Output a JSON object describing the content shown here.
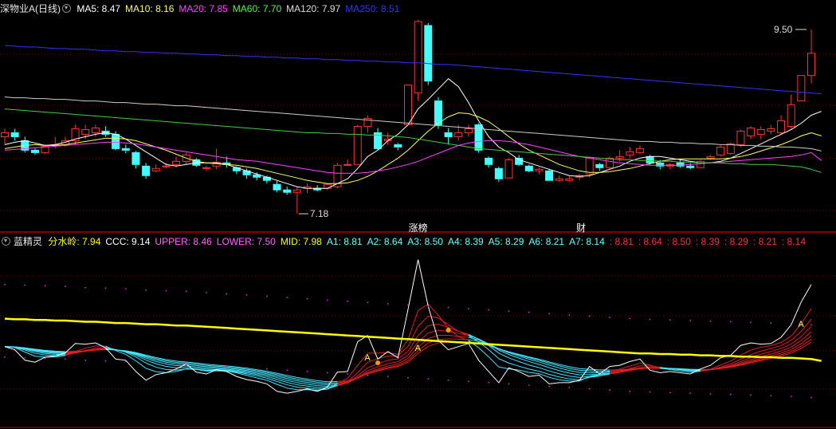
{
  "top_panel": {
    "title": "深物业A(日线)",
    "ma": [
      {
        "label": "MA5: 8.47",
        "color": "#ffffff"
      },
      {
        "label": "MA10: 8.16",
        "color": "#ffff66"
      },
      {
        "label": "MA20: 7.85",
        "color": "#ff44ff"
      },
      {
        "label": "MA60: 7.70",
        "color": "#44ff44"
      },
      {
        "label": "MA120: 7.97",
        "color": "#dddddd"
      },
      {
        "label": "MA250: 8.51",
        "color": "#3333ff"
      }
    ],
    "annotations": {
      "high_label": "9.50",
      "low_label": "7.18",
      "tag1": "涨榜",
      "tag2": "财"
    }
  },
  "bottom_panel": {
    "title": "蓝精灵",
    "items": [
      {
        "label": "分水岭: 7.94",
        "color": "#ffff00"
      },
      {
        "label": "CCC: 9.14",
        "color": "#ffffff"
      },
      {
        "label": "UPPER: 8.46",
        "color": "#ff66ff"
      },
      {
        "label": "LOWER: 7.50",
        "color": "#ff66ff"
      },
      {
        "label": "MID: 7.98",
        "color": "#ffff00"
      },
      {
        "label": "A1: 8.81",
        "color": "#66ffff"
      },
      {
        "label": "A2: 8.64",
        "color": "#66ffff"
      },
      {
        "label": "A3: 8.50",
        "color": "#66ffff"
      },
      {
        "label": "A4: 8.39",
        "color": "#66ffff"
      },
      {
        "label": "A5: 8.29",
        "color": "#66ffff"
      },
      {
        "label": "A6: 8.21",
        "color": "#66ffff"
      },
      {
        "label": "A7: 8.14",
        "color": "#66ffff"
      },
      {
        "label": ": 8.81",
        "color": "#ff3333"
      },
      {
        "label": ": 8.64",
        "color": "#ff3333"
      },
      {
        "label": ": 8.50",
        "color": "#ff3333"
      },
      {
        "label": ": 8.39",
        "color": "#ff3333"
      },
      {
        "label": ": 8.29",
        "color": "#ff3333"
      },
      {
        "label": ": 8.21",
        "color": "#ff3333"
      },
      {
        "label": ": 8.14",
        "color": "#ff3333"
      }
    ],
    "marker_letter": "A"
  },
  "colors": {
    "up": "#ff3333",
    "down": "#44ffff",
    "grid": "#7a0000",
    "axis": "#b00000"
  },
  "chart_data": {
    "type": "candlestick",
    "ylim": [
      7.0,
      9.65
    ],
    "grid": true,
    "candles": [
      {
        "o": 8.15,
        "h": 8.25,
        "l": 8.05,
        "c": 8.2
      },
      {
        "o": 8.2,
        "h": 8.25,
        "l": 8.1,
        "c": 8.15
      },
      {
        "o": 8.1,
        "h": 8.15,
        "l": 7.95,
        "c": 7.98
      },
      {
        "o": 7.98,
        "h": 8.0,
        "l": 7.92,
        "c": 7.95
      },
      {
        "o": 7.95,
        "h": 8.05,
        "l": 7.93,
        "c": 8.03
      },
      {
        "o": 8.05,
        "h": 8.15,
        "l": 8.0,
        "c": 8.05
      },
      {
        "o": 8.05,
        "h": 8.15,
        "l": 8.02,
        "c": 8.1
      },
      {
        "o": 8.1,
        "h": 8.3,
        "l": 8.05,
        "c": 8.25
      },
      {
        "o": 8.18,
        "h": 8.3,
        "l": 8.12,
        "c": 8.24
      },
      {
        "o": 8.2,
        "h": 8.3,
        "l": 8.15,
        "c": 8.26
      },
      {
        "o": 8.22,
        "h": 8.28,
        "l": 8.15,
        "c": 8.18
      },
      {
        "o": 8.18,
        "h": 8.22,
        "l": 7.98,
        "c": 8.0
      },
      {
        "o": 8.0,
        "h": 8.05,
        "l": 7.94,
        "c": 7.98
      },
      {
        "o": 7.95,
        "h": 7.97,
        "l": 7.75,
        "c": 7.8
      },
      {
        "o": 7.78,
        "h": 7.82,
        "l": 7.62,
        "c": 7.66
      },
      {
        "o": 7.72,
        "h": 7.8,
        "l": 7.7,
        "c": 7.75
      },
      {
        "o": 7.78,
        "h": 7.82,
        "l": 7.75,
        "c": 7.78
      },
      {
        "o": 7.8,
        "h": 7.9,
        "l": 7.76,
        "c": 7.84
      },
      {
        "o": 7.84,
        "h": 7.95,
        "l": 7.8,
        "c": 7.92
      },
      {
        "o": 7.86,
        "h": 7.88,
        "l": 7.77,
        "c": 7.79
      },
      {
        "o": 7.75,
        "h": 7.78,
        "l": 7.72,
        "c": 7.76
      },
      {
        "o": 7.78,
        "h": 8.0,
        "l": 7.74,
        "c": 7.83
      },
      {
        "o": 7.82,
        "h": 7.9,
        "l": 7.76,
        "c": 7.8
      },
      {
        "o": 7.76,
        "h": 7.78,
        "l": 7.68,
        "c": 7.72
      },
      {
        "o": 7.72,
        "h": 7.75,
        "l": 7.62,
        "c": 7.67
      },
      {
        "o": 7.67,
        "h": 7.7,
        "l": 7.6,
        "c": 7.64
      },
      {
        "o": 7.64,
        "h": 7.66,
        "l": 7.56,
        "c": 7.6
      },
      {
        "o": 7.55,
        "h": 7.6,
        "l": 7.45,
        "c": 7.48
      },
      {
        "o": 7.48,
        "h": 7.52,
        "l": 7.42,
        "c": 7.45
      },
      {
        "o": 7.45,
        "h": 7.52,
        "l": 7.18,
        "c": 7.48
      },
      {
        "o": 7.5,
        "h": 7.56,
        "l": 7.44,
        "c": 7.52
      },
      {
        "o": 7.5,
        "h": 7.54,
        "l": 7.46,
        "c": 7.48
      },
      {
        "o": 7.5,
        "h": 7.56,
        "l": 7.48,
        "c": 7.55
      },
      {
        "o": 7.52,
        "h": 7.82,
        "l": 7.5,
        "c": 7.79
      },
      {
        "o": 7.8,
        "h": 7.86,
        "l": 7.78,
        "c": 7.8
      },
      {
        "o": 7.8,
        "h": 8.3,
        "l": 7.82,
        "c": 8.28
      },
      {
        "o": 8.28,
        "h": 8.42,
        "l": 8.2,
        "c": 8.38
      },
      {
        "o": 8.2,
        "h": 8.26,
        "l": 7.98,
        "c": 8.0
      },
      {
        "o": 8.1,
        "h": 8.2,
        "l": 8.05,
        "c": 8.12
      },
      {
        "o": 8.05,
        "h": 8.07,
        "l": 7.98,
        "c": 8.02
      },
      {
        "o": 8.3,
        "h": 8.8,
        "l": 8.3,
        "c": 8.8
      },
      {
        "o": 8.7,
        "h": 9.62,
        "l": 8.6,
        "c": 9.6
      },
      {
        "o": 9.55,
        "h": 9.58,
        "l": 8.8,
        "c": 8.85
      },
      {
        "o": 8.6,
        "h": 8.65,
        "l": 8.25,
        "c": 8.3
      },
      {
        "o": 8.2,
        "h": 8.26,
        "l": 8.05,
        "c": 8.15
      },
      {
        "o": 8.15,
        "h": 8.3,
        "l": 8.1,
        "c": 8.2
      },
      {
        "o": 8.2,
        "h": 8.3,
        "l": 8.15,
        "c": 8.25
      },
      {
        "o": 8.3,
        "h": 8.32,
        "l": 7.95,
        "c": 7.98
      },
      {
        "o": 7.88,
        "h": 7.9,
        "l": 7.76,
        "c": 7.8
      },
      {
        "o": 7.75,
        "h": 7.77,
        "l": 7.58,
        "c": 7.62
      },
      {
        "o": 7.63,
        "h": 7.88,
        "l": 7.63,
        "c": 7.86
      },
      {
        "o": 7.88,
        "h": 7.92,
        "l": 7.78,
        "c": 7.8
      },
      {
        "o": 7.78,
        "h": 7.8,
        "l": 7.7,
        "c": 7.72
      },
      {
        "o": 7.72,
        "h": 7.76,
        "l": 7.68,
        "c": 7.74
      },
      {
        "o": 7.72,
        "h": 7.74,
        "l": 7.6,
        "c": 7.6
      },
      {
        "o": 7.6,
        "h": 7.66,
        "l": 7.58,
        "c": 7.62
      },
      {
        "o": 7.6,
        "h": 7.66,
        "l": 7.58,
        "c": 7.62
      },
      {
        "o": 7.64,
        "h": 7.68,
        "l": 7.6,
        "c": 7.66
      },
      {
        "o": 7.68,
        "h": 7.9,
        "l": 7.64,
        "c": 7.88
      },
      {
        "o": 7.8,
        "h": 7.82,
        "l": 7.72,
        "c": 7.76
      },
      {
        "o": 7.76,
        "h": 7.9,
        "l": 7.74,
        "c": 7.88
      },
      {
        "o": 7.88,
        "h": 7.98,
        "l": 7.84,
        "c": 7.9
      },
      {
        "o": 7.92,
        "h": 8.02,
        "l": 7.88,
        "c": 7.96
      },
      {
        "o": 7.95,
        "h": 8.04,
        "l": 7.93,
        "c": 8.0
      },
      {
        "o": 7.9,
        "h": 7.92,
        "l": 7.8,
        "c": 7.82
      },
      {
        "o": 7.82,
        "h": 7.86,
        "l": 7.74,
        "c": 7.78
      },
      {
        "o": 7.78,
        "h": 7.82,
        "l": 7.74,
        "c": 7.8
      },
      {
        "o": 7.82,
        "h": 7.86,
        "l": 7.76,
        "c": 7.78
      },
      {
        "o": 7.78,
        "h": 7.82,
        "l": 7.74,
        "c": 7.76
      },
      {
        "o": 7.76,
        "h": 7.86,
        "l": 7.76,
        "c": 7.84
      },
      {
        "o": 7.88,
        "h": 7.92,
        "l": 7.86,
        "c": 7.9
      },
      {
        "o": 7.92,
        "h": 8.04,
        "l": 7.9,
        "c": 8.02
      },
      {
        "o": 7.94,
        "h": 8.08,
        "l": 7.92,
        "c": 8.06
      },
      {
        "o": 8.05,
        "h": 8.24,
        "l": 8.02,
        "c": 8.22
      },
      {
        "o": 8.16,
        "h": 8.28,
        "l": 8.12,
        "c": 8.26
      },
      {
        "o": 8.18,
        "h": 8.28,
        "l": 8.12,
        "c": 8.24
      },
      {
        "o": 8.22,
        "h": 8.3,
        "l": 8.18,
        "c": 8.25
      },
      {
        "o": 8.2,
        "h": 8.42,
        "l": 8.18,
        "c": 8.35
      },
      {
        "o": 8.28,
        "h": 8.68,
        "l": 8.25,
        "c": 8.55
      },
      {
        "o": 8.6,
        "h": 8.92,
        "l": 8.6,
        "c": 8.92
      },
      {
        "o": 8.92,
        "h": 9.5,
        "l": 8.82,
        "c": 9.2
      }
    ],
    "ma_series": {
      "MA5": [
        8.05,
        8.08,
        8.1,
        8.07,
        8.04,
        8.05,
        8.08,
        8.12,
        8.15,
        8.18,
        8.2,
        8.18,
        8.12,
        8.04,
        7.96,
        7.88,
        7.8,
        7.78,
        7.8,
        7.82,
        7.82,
        7.82,
        7.8,
        7.76,
        7.72,
        7.68,
        7.64,
        7.6,
        7.56,
        7.52,
        7.5,
        7.5,
        7.5,
        7.56,
        7.62,
        7.75,
        7.9,
        7.98,
        8.1,
        8.18,
        8.3,
        8.5,
        8.62,
        8.75,
        8.88,
        8.78,
        8.58,
        8.35,
        8.15,
        8.02,
        7.95,
        7.86,
        7.82,
        7.78,
        7.74,
        7.7,
        7.66,
        7.65,
        7.66,
        7.7,
        7.74,
        7.78,
        7.84,
        7.88,
        7.9,
        7.9,
        7.88,
        7.86,
        7.84,
        7.82,
        7.82,
        7.84,
        7.88,
        7.94,
        8.0,
        8.06,
        8.12,
        8.18,
        8.24,
        8.32,
        8.42,
        8.47
      ],
      "MA10": [
        8.0,
        8.02,
        8.04,
        8.05,
        8.04,
        8.04,
        8.05,
        8.07,
        8.09,
        8.11,
        8.13,
        8.13,
        8.12,
        8.1,
        8.06,
        8.02,
        7.98,
        7.93,
        7.88,
        7.84,
        7.82,
        7.81,
        7.8,
        7.79,
        7.77,
        7.75,
        7.72,
        7.69,
        7.66,
        7.63,
        7.6,
        7.58,
        7.56,
        7.56,
        7.57,
        7.6,
        7.65,
        7.72,
        7.8,
        7.88,
        7.98,
        8.1,
        8.22,
        8.32,
        8.4,
        8.45,
        8.44,
        8.4,
        8.34,
        8.25,
        8.15,
        8.06,
        7.98,
        7.92,
        7.86,
        7.8,
        7.76,
        7.72,
        7.7,
        7.7,
        7.71,
        7.73,
        7.75,
        7.78,
        7.81,
        7.84,
        7.86,
        7.87,
        7.87,
        7.87,
        7.87,
        7.87,
        7.88,
        7.9,
        7.93,
        7.97,
        8.01,
        8.05,
        8.1,
        8.16,
        8.2,
        8.16
      ],
      "MA20": [
        7.98,
        7.99,
        8.0,
        8.01,
        8.02,
        8.03,
        8.04,
        8.05,
        8.06,
        8.07,
        8.08,
        8.08,
        8.07,
        8.06,
        8.04,
        8.02,
        8.0,
        7.98,
        7.96,
        7.94,
        7.92,
        7.9,
        7.88,
        7.86,
        7.85,
        7.84,
        7.82,
        7.8,
        7.78,
        7.76,
        7.74,
        7.72,
        7.7,
        7.69,
        7.69,
        7.69,
        7.7,
        7.72,
        7.74,
        7.77,
        7.8,
        7.84,
        7.89,
        7.94,
        7.99,
        8.04,
        8.07,
        8.09,
        8.1,
        8.1,
        8.09,
        8.07,
        8.05,
        8.02,
        7.99,
        7.96,
        7.93,
        7.9,
        7.88,
        7.86,
        7.84,
        7.82,
        7.81,
        7.8,
        7.79,
        7.79,
        7.79,
        7.79,
        7.8,
        7.81,
        7.82,
        7.83,
        7.84,
        7.85,
        7.86,
        7.87,
        7.88,
        7.89,
        7.9,
        7.92,
        7.95,
        7.85
      ],
      "MA60": [
        8.5,
        8.49,
        8.48,
        8.47,
        8.46,
        8.45,
        8.44,
        8.43,
        8.42,
        8.41,
        8.4,
        8.39,
        8.38,
        8.37,
        8.36,
        8.35,
        8.34,
        8.33,
        8.32,
        8.31,
        8.3,
        8.29,
        8.28,
        8.27,
        8.26,
        8.25,
        8.24,
        8.23,
        8.22,
        8.21,
        8.2,
        8.2,
        8.19,
        8.19,
        8.18,
        8.18,
        8.17,
        8.17,
        8.16,
        8.15,
        8.14,
        8.12,
        8.1,
        8.08,
        8.06,
        8.04,
        8.02,
        8.0,
        7.99,
        7.98,
        7.97,
        7.96,
        7.95,
        7.94,
        7.93,
        7.92,
        7.91,
        7.9,
        7.89,
        7.88,
        7.87,
        7.86,
        7.86,
        7.85,
        7.85,
        7.84,
        7.84,
        7.83,
        7.83,
        7.82,
        7.82,
        7.82,
        7.81,
        7.81,
        7.8,
        7.8,
        7.8,
        7.79,
        7.78,
        7.77,
        7.74,
        7.7
      ],
      "MA120": [
        8.65,
        8.64,
        8.64,
        8.63,
        8.63,
        8.62,
        8.62,
        8.61,
        8.6,
        8.6,
        8.59,
        8.58,
        8.58,
        8.57,
        8.56,
        8.56,
        8.55,
        8.54,
        8.54,
        8.53,
        8.52,
        8.51,
        8.5,
        8.49,
        8.48,
        8.47,
        8.46,
        8.45,
        8.44,
        8.43,
        8.42,
        8.41,
        8.4,
        8.39,
        8.38,
        8.37,
        8.36,
        8.35,
        8.34,
        8.33,
        8.32,
        8.31,
        8.3,
        8.29,
        8.28,
        8.27,
        8.26,
        8.25,
        8.24,
        8.23,
        8.22,
        8.21,
        8.2,
        8.19,
        8.18,
        8.17,
        8.16,
        8.15,
        8.14,
        8.13,
        8.12,
        8.11,
        8.1,
        8.09,
        8.09,
        8.08,
        8.08,
        8.07,
        8.07,
        8.06,
        8.06,
        8.05,
        8.05,
        8.04,
        8.04,
        8.03,
        8.03,
        8.02,
        8.02,
        8.01,
        8.0,
        7.97
      ],
      "MA250": [
        9.3,
        9.29,
        9.28,
        9.28,
        9.27,
        9.26,
        9.26,
        9.25,
        9.25,
        9.24,
        9.23,
        9.23,
        9.22,
        9.22,
        9.21,
        9.21,
        9.2,
        9.2,
        9.19,
        9.19,
        9.18,
        9.18,
        9.17,
        9.17,
        9.16,
        9.16,
        9.15,
        9.15,
        9.14,
        9.14,
        9.13,
        9.13,
        9.12,
        9.12,
        9.11,
        9.11,
        9.1,
        9.1,
        9.09,
        9.09,
        9.08,
        9.08,
        9.07,
        9.06,
        9.06,
        9.05,
        9.04,
        9.03,
        9.02,
        9.01,
        9.0,
        8.99,
        8.98,
        8.97,
        8.96,
        8.95,
        8.94,
        8.93,
        8.92,
        8.91,
        8.9,
        8.89,
        8.88,
        8.87,
        8.86,
        8.85,
        8.84,
        8.83,
        8.82,
        8.81,
        8.8,
        8.79,
        8.78,
        8.77,
        8.76,
        8.75,
        8.74,
        8.73,
        8.72,
        8.71,
        8.7,
        8.69
      ]
    }
  }
}
